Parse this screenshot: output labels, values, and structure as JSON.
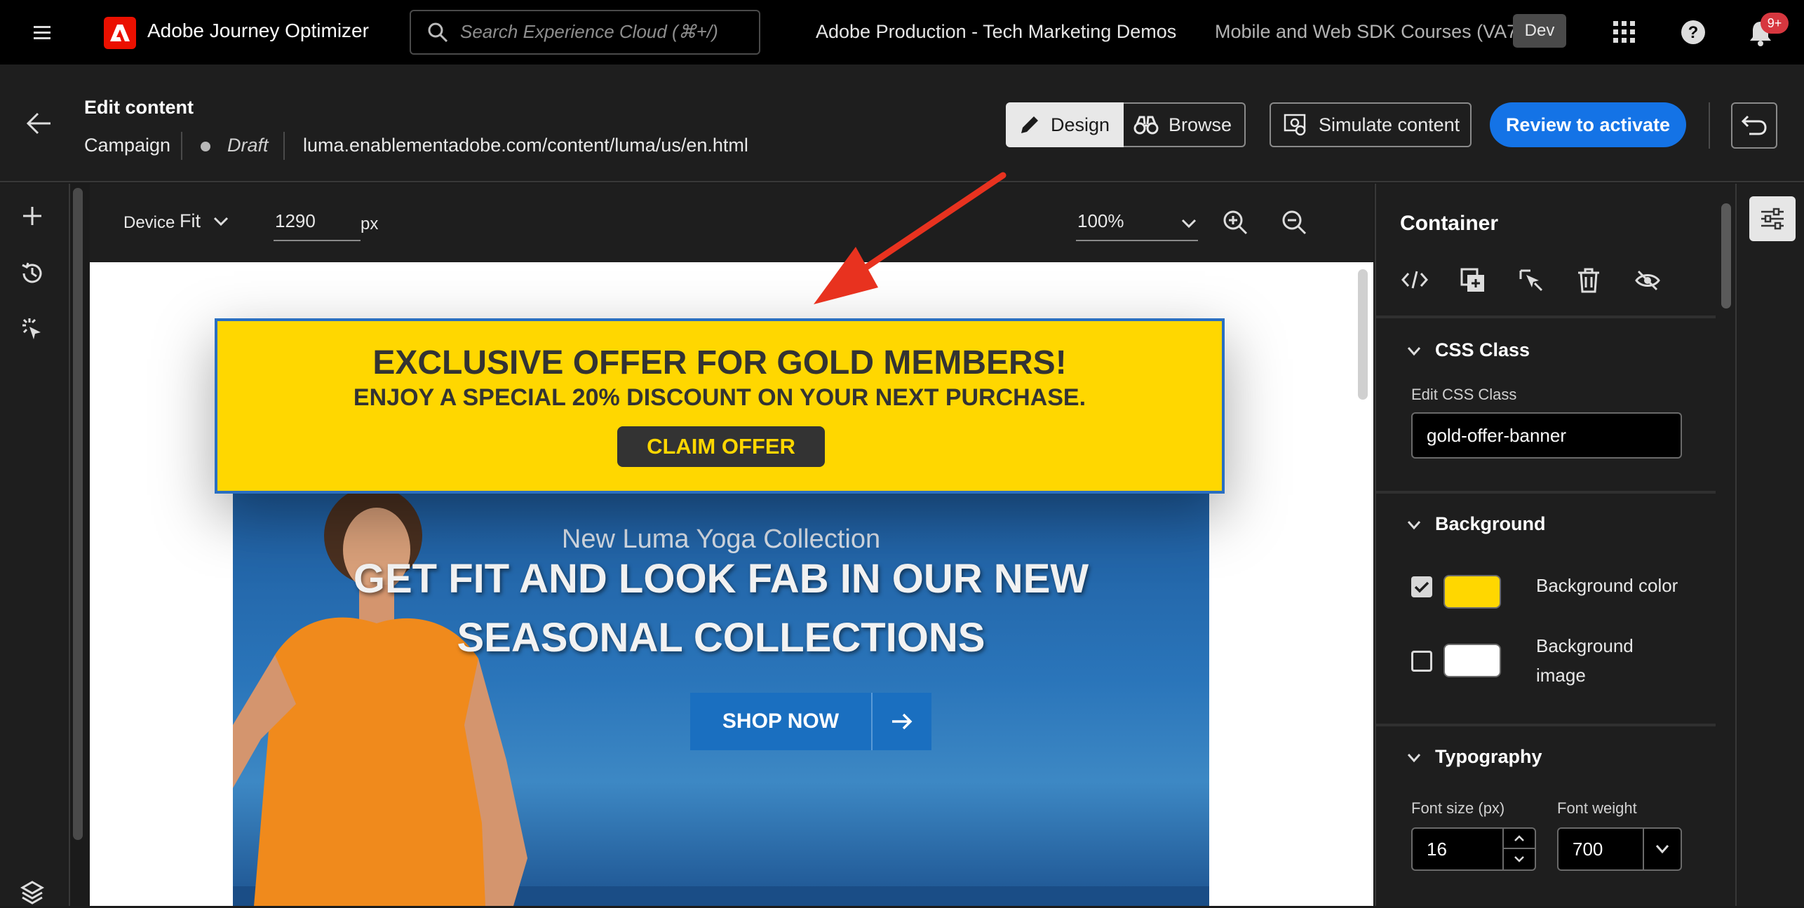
{
  "topnav": {
    "app_name": "Adobe Journey Optimizer",
    "search_placeholder": "Search Experience Cloud (⌘+/)",
    "org": "Adobe Production - Tech Marketing Demos",
    "sandbox": "Mobile and Web SDK Courses (VA7)",
    "env_badge": "Dev",
    "notification_count": "9+"
  },
  "header": {
    "title": "Edit content",
    "type": "Campaign",
    "status": "Draft",
    "url": "luma.enablementadobe.com/content/luma/us/en.html",
    "design_label": "Design",
    "browse_label": "Browse",
    "simulate_label": "Simulate content",
    "review_label": "Review to activate"
  },
  "canvas_toolbar": {
    "device_label": "Device",
    "device_value": "Fit",
    "width_value": "1290",
    "width_unit": "px",
    "zoom_value": "100%"
  },
  "page": {
    "banner": {
      "title": "EXCLUSIVE OFFER FOR GOLD MEMBERS!",
      "subtitle": "ENJOY A SPECIAL 20% DISCOUNT ON YOUR NEXT PURCHASE.",
      "button": "CLAIM OFFER",
      "bg_color": "#ffd700"
    },
    "hero": {
      "subtitle": "New Luma Yoga Collection",
      "title_line1": "GET FIT AND LOOK FAB IN OUR NEW",
      "title_line2": "SEASONAL COLLECTIONS",
      "button": "SHOP NOW"
    }
  },
  "panel": {
    "title": "Container",
    "css_section": "CSS Class",
    "css_label": "Edit CSS Class",
    "css_value": "gold-offer-banner",
    "bg_section": "Background",
    "bg_color_label": "Background color",
    "bg_color_checked": true,
    "bg_color_value": "#ffd700",
    "bg_image_label_1": "Background",
    "bg_image_label_2": "image",
    "bg_image_checked": false,
    "typo_section": "Typography",
    "font_size_label": "Font size (px)",
    "font_size_value": "16",
    "font_weight_label": "Font weight",
    "font_weight_value": "700"
  },
  "colors": {
    "accent": "#1473e6",
    "adobe_red": "#eb1000",
    "annotation_arrow": "#e8321f"
  }
}
